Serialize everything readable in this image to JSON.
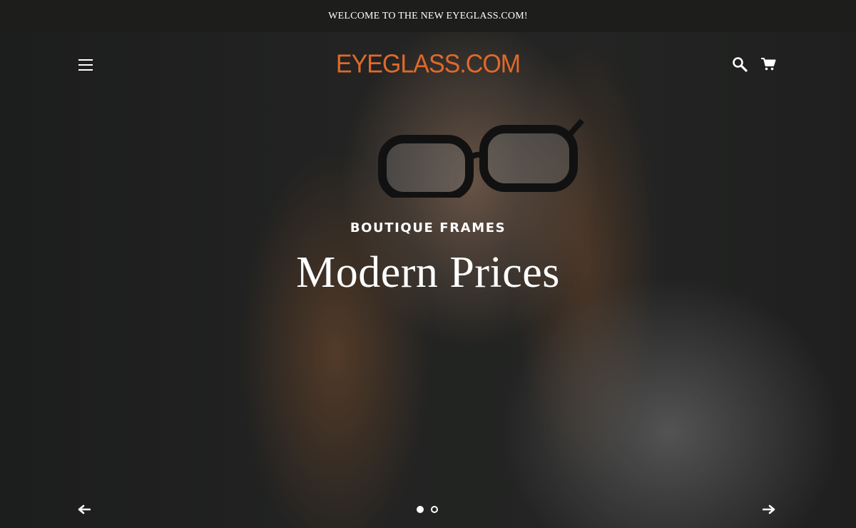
{
  "announcement": {
    "text": "WELCOME TO THE NEW EYEGLASS.COM!"
  },
  "header": {
    "menu_icon": "hamburger-menu-icon",
    "logo_text": "EYEGLASS.COM",
    "logo_color": "#e0692b",
    "search_icon": "search-icon",
    "cart_icon": "cart-icon"
  },
  "hero": {
    "subtitle": "BOUTIQUE FRAMES",
    "title": "Modern Prices",
    "prev_icon": "arrow-left-icon",
    "next_icon": "arrow-right-icon",
    "slides_total": 2,
    "slide_active": 1
  }
}
